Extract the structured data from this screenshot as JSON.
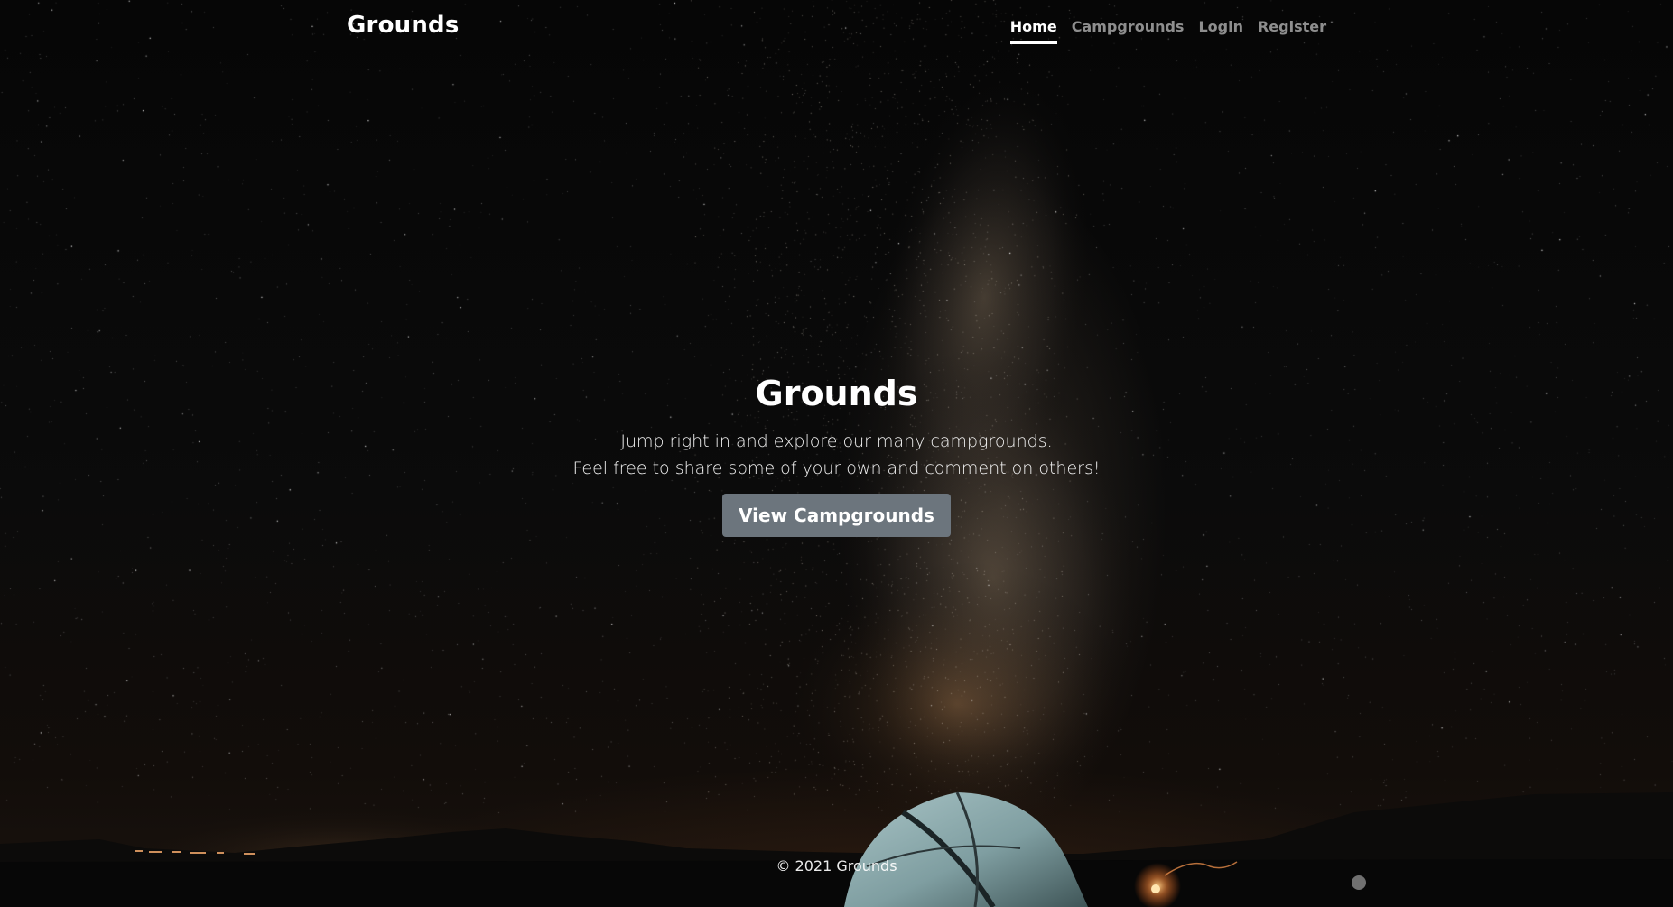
{
  "header": {
    "brand": "Grounds",
    "nav": [
      {
        "label": "Home",
        "active": true
      },
      {
        "label": "Campgrounds",
        "active": false
      },
      {
        "label": "Login",
        "active": false
      },
      {
        "label": "Register",
        "active": false
      }
    ]
  },
  "hero": {
    "title": "Grounds",
    "line1": "Jump right in and explore our many campgrounds.",
    "line2": "Feel free to share some of your own and comment on others!",
    "button_label": "View Campgrounds"
  },
  "footer": {
    "text": "© 2021 Grounds"
  },
  "colors": {
    "button_bg": "#6c757d",
    "nav_active": "#ffffff",
    "nav_inactive": "rgba(255,255,255,0.55)"
  }
}
